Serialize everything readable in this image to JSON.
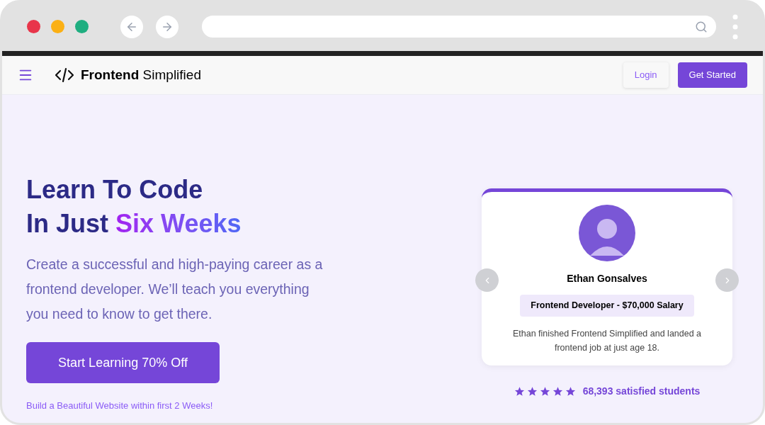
{
  "nav": {
    "brand": "**Frontend** Simplified",
    "login": "Login",
    "cta": "Get Started"
  },
  "hero": {
    "heading_line1": "Learn To Code",
    "heading_line2": "In Just ",
    "heading_highlight": "Six Weeks",
    "subtitle": "Create a successful and high-paying career as a frontend developer. We’ll teach you everything you need to know to get there.",
    "button": "Start Learning 70% Off",
    "note": "Build a Beautiful Website within first 2 Weeks!"
  },
  "testimonial": {
    "name": "Ethan Gonsalves",
    "role": "Frontend Developer - $70,000 Salary",
    "quote": "Ethan finished Frontend Simplified and landed a frontend job at just age 18."
  },
  "rating": {
    "stars": 5,
    "text": "68,393 satisfied students"
  }
}
